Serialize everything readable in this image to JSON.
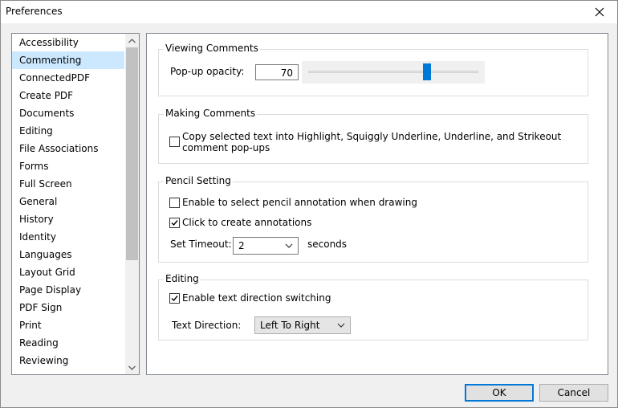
{
  "window": {
    "title": "Preferences"
  },
  "categories": [
    "Accessibility",
    "Commenting",
    "ConnectedPDF",
    "Create PDF",
    "Documents",
    "Editing",
    "File Associations",
    "Forms",
    "Full Screen",
    "General",
    "History",
    "Identity",
    "Languages",
    "Layout Grid",
    "Page Display",
    "PDF Sign",
    "Print",
    "Reading",
    "Reviewing"
  ],
  "selected_category": "Commenting",
  "viewing": {
    "title": "Viewing Comments",
    "opacity_label": "Pop-up opacity:",
    "opacity_value": "70",
    "slider_fraction": 0.7
  },
  "making": {
    "title": "Making Comments",
    "copy_line1": "Copy selected text into Highlight, Squiggly Underline, Underline, and Strikeout",
    "copy_line2": "comment pop-ups",
    "copy_checked": false
  },
  "pencil": {
    "title": "Pencil Setting",
    "enable_label": "Enable to select pencil annotation when drawing",
    "enable_checked": false,
    "click_label": "Click to create annotations",
    "click_checked": true,
    "timeout_label": "Set Timeout:",
    "timeout_value": "2",
    "timeout_unit": "seconds"
  },
  "editing": {
    "title": "Editing",
    "direction_label": "Enable text direction switching",
    "direction_checked": true,
    "text_direction_label": "Text Direction:",
    "text_direction_value": "Left To Right"
  },
  "buttons": {
    "ok": "OK",
    "cancel": "Cancel"
  },
  "colors": {
    "accent": "#0078d7",
    "selection": "#cce8ff"
  }
}
